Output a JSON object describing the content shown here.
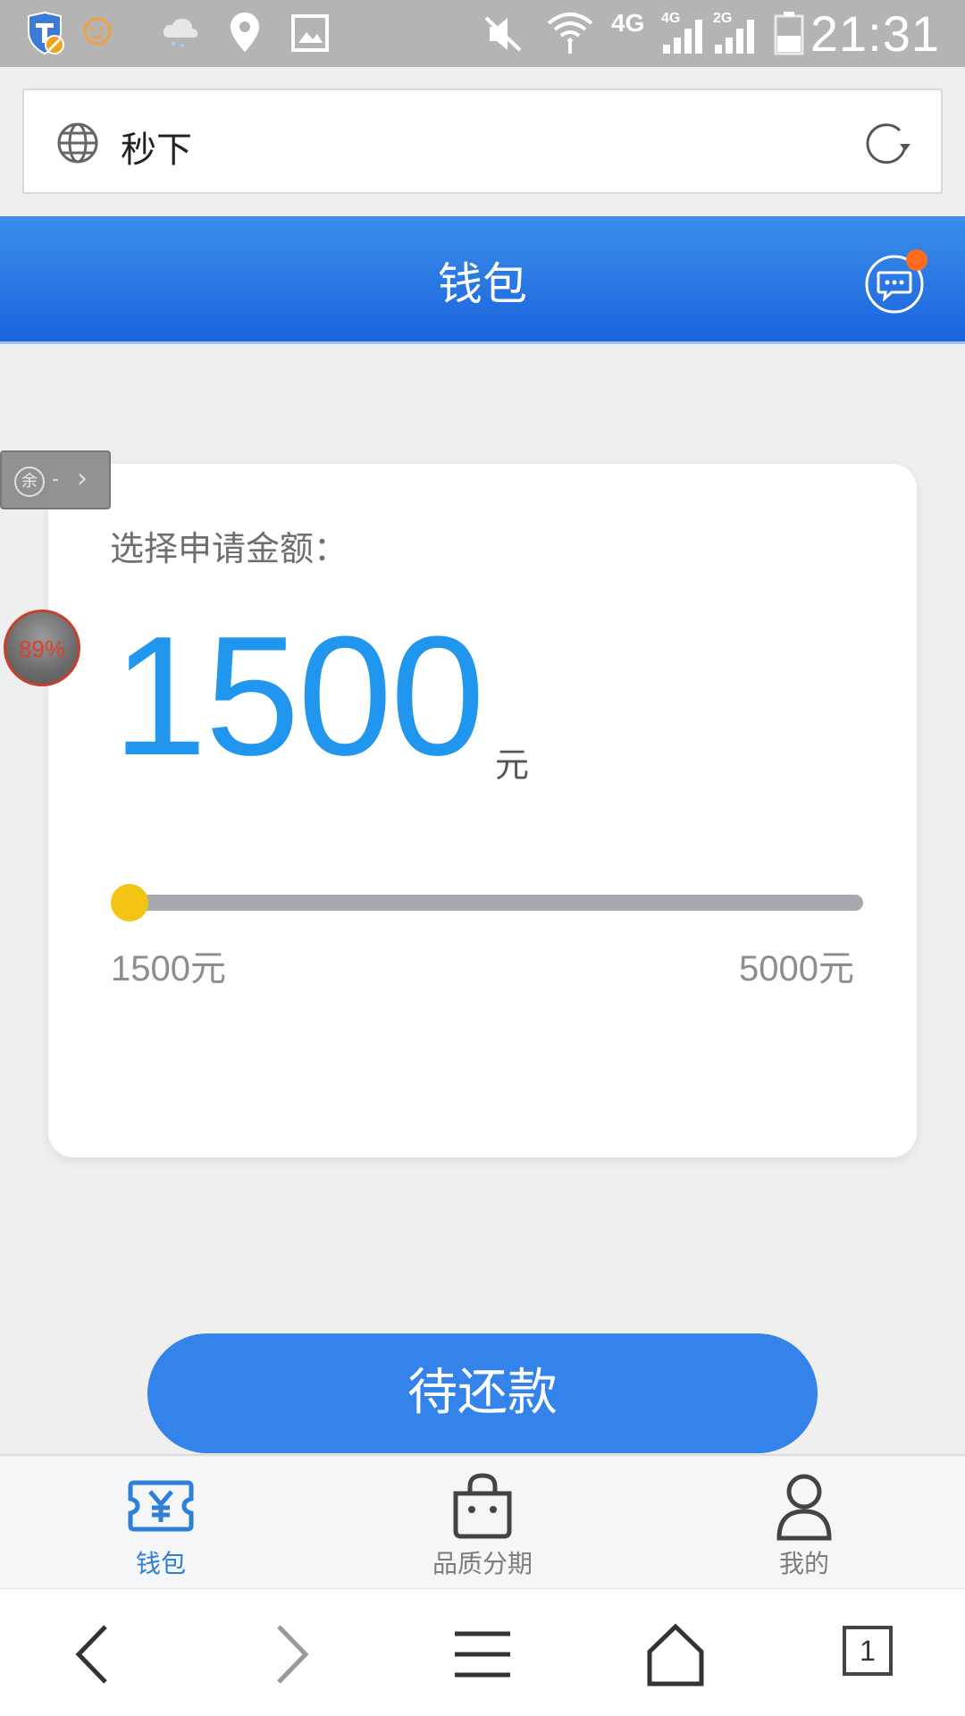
{
  "status_bar": {
    "time": "21:31",
    "network_4g": "4G",
    "network_4g_small": "4G",
    "network_2g_small": "2G"
  },
  "address_bar": {
    "text": "秒下"
  },
  "header": {
    "title": "钱包"
  },
  "floating": {
    "tab_icon_char": "余",
    "tab_dash": "-",
    "tab_chevron": "›",
    "battery_percent": "89%"
  },
  "card": {
    "prompt": "选择申请金额：",
    "amount": "1500",
    "unit": "元",
    "slider": {
      "value": 1500,
      "min": 1500,
      "max": 5000,
      "min_label": "1500元",
      "max_label": "5000元"
    }
  },
  "primary_button": {
    "label": "待还款"
  },
  "bottom_nav": {
    "items": [
      {
        "label": "钱包",
        "icon": "wallet-yen-icon",
        "active": true
      },
      {
        "label": "品质分期",
        "icon": "shopping-bag-icon",
        "active": false
      },
      {
        "label": "我的",
        "icon": "user-icon",
        "active": false
      }
    ]
  },
  "browser_bar": {
    "tab_count": "1"
  },
  "colors": {
    "accent": "#2196ef",
    "header": "#1c64de",
    "button": "#3383ea",
    "thumb": "#f4c414",
    "nav_active": "#2d7fd9",
    "nav_inactive": "#7d7d7d"
  }
}
